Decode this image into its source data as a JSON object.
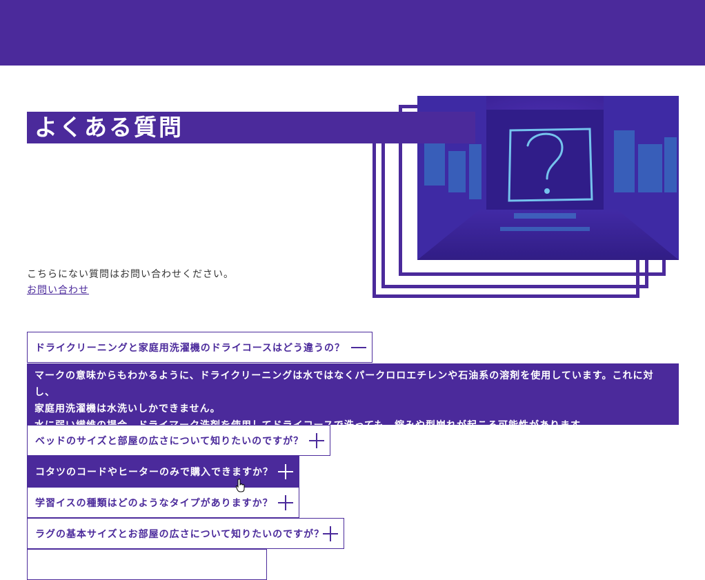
{
  "page": {
    "title": "よくある質問",
    "intro": "こちらにない質問はお問い合わせください。",
    "contact_link": "お問い合わせ"
  },
  "colors": {
    "brand": "#4b2a9b",
    "background": "#ffffff",
    "text": "#333333"
  },
  "hero_image": {
    "description_icon": "question-mark-neon-icon"
  },
  "faq": [
    {
      "question": "ドライクリーニングと家庭用洗濯機のドライコースはどう違うの？",
      "expanded": true,
      "icon": "minus-icon"
    },
    {
      "question": "ベッドのサイズと部屋の広さについて知りたいのですが？",
      "expanded": false,
      "icon": "plus-icon"
    },
    {
      "question": "コタツのコードやヒーターのみで購入できますか？",
      "expanded": false,
      "icon": "plus-icon",
      "hovered": true
    },
    {
      "question": "学習イスの種類はどのようなタイプがありますか？",
      "expanded": false,
      "icon": "plus-icon"
    },
    {
      "question": "ラグの基本サイズとお部屋の広さについて知りたいのですが？",
      "expanded": false,
      "icon": "plus-icon"
    }
  ],
  "answer": {
    "line1": "マークの意味からもわかるように、ドライクリーニングは水ではなくパークロロエチレンや石油系の溶剤を使用しています。これに対し、",
    "line2": "家庭用洗濯機は水洗いしかできません。",
    "line3": "水に弱い繊維の場合、ドライマーク洗剤を使用してドライコースで洗っても、縮みや型崩れが起こる可能性があります。"
  }
}
